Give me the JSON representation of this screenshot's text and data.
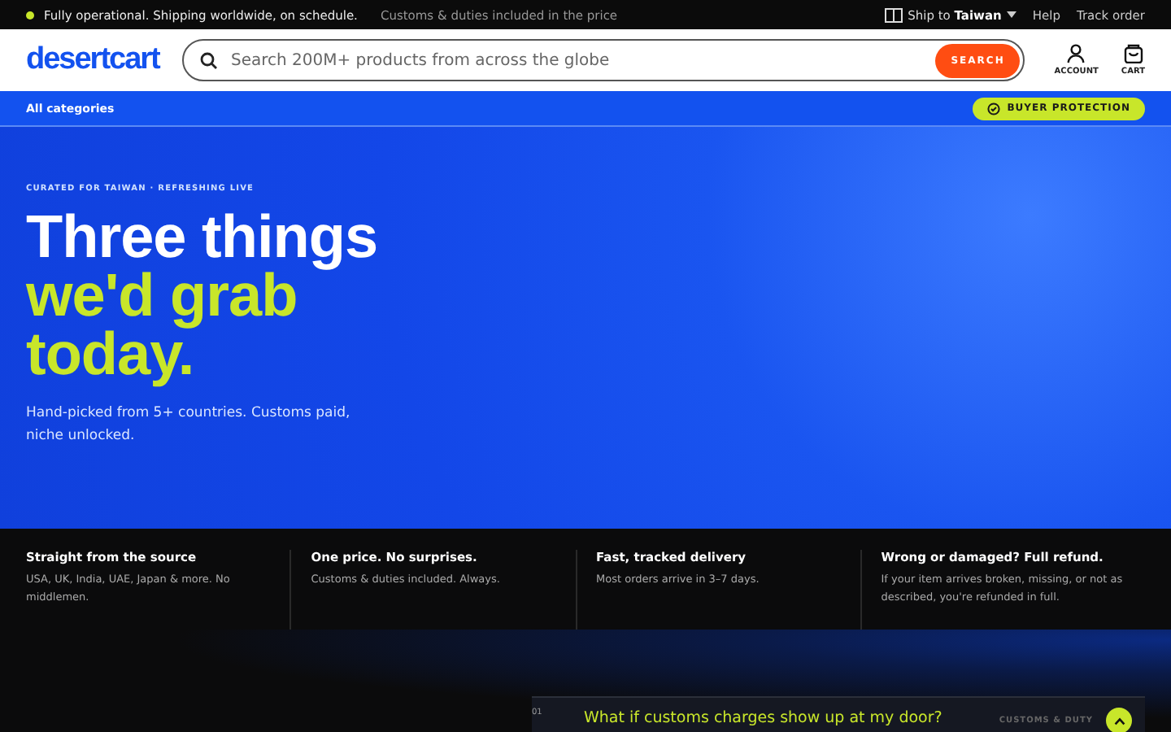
{
  "top_bar": {
    "status": "Fully operational. Shipping worldwide, on schedule.",
    "note": "Customs & duties included in the price",
    "ship_to_label": "Ship to",
    "ship_to_country": "Taiwan",
    "links": [
      "Help",
      "Track order"
    ]
  },
  "header": {
    "logo": "desertcart",
    "search": {
      "placeholder": "Search 200M+ products from across the globe",
      "button": "SEARCH"
    },
    "actions": [
      {
        "kind": "account",
        "label": "ACCOUNT"
      },
      {
        "kind": "cart",
        "label": "CART"
      }
    ]
  },
  "nav": {
    "categories": "All categories",
    "badge": "BUYER PROTECTION"
  },
  "hero": {
    "eyebrow": "CURATED FOR TAIWAN · REFRESHING LIVE",
    "title_lines": [
      {
        "text": "Three things",
        "accent": false
      },
      {
        "text": "we'd grab",
        "accent": true
      },
      {
        "text": "today.",
        "accent": true
      }
    ],
    "subtitle": "Hand-picked from 5+ countries. Customs paid, niche unlocked."
  },
  "features": [
    {
      "title": "Straight from the source",
      "text": "USA, UK, India, UAE, Japan & more. No middlemen."
    },
    {
      "title": "One price. No surprises.",
      "text": "Customs & duties included. Always."
    },
    {
      "title": "Fast, tracked delivery",
      "text": "Most orders arrive in 3–7 days."
    },
    {
      "title": "Wrong or damaged? Full refund.",
      "text": "If your item arrives broken, missing, or not as described, you're refunded in full."
    }
  ],
  "faq": [
    {
      "number": "01",
      "question": "What if customs charges show up at my door?",
      "tag": "CUSTOMS & DUTY"
    }
  ]
}
